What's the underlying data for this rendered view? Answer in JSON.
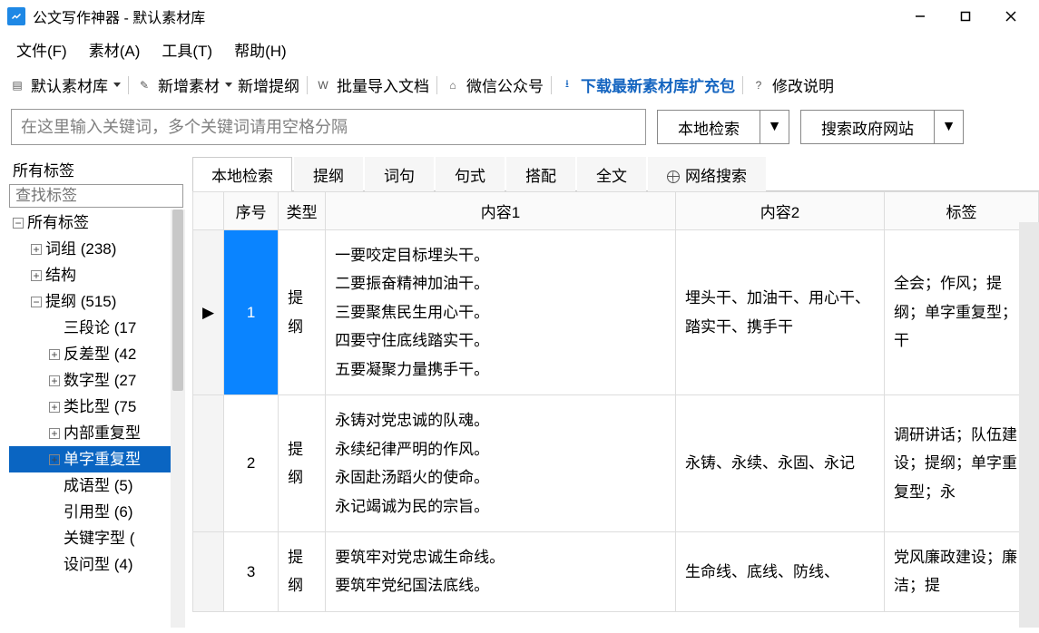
{
  "app": {
    "title": "公文写作神器 - 默认素材库"
  },
  "menu": {
    "file": "文件(F)",
    "material": "素材(A)",
    "tool": "工具(T)",
    "help": "帮助(H)"
  },
  "toolbar": {
    "default_lib": "默认素材库",
    "add_material": "新增素材",
    "add_outline": "新增提纲",
    "batch_import": "批量导入文档",
    "wechat": "微信公众号",
    "download_pack": "下载最新素材库扩充包",
    "changelog": "修改说明"
  },
  "search": {
    "placeholder": "在这里输入关键词，多个关键词请用空格分隔",
    "local_label": "本地检索",
    "gov_label": "搜索政府网站"
  },
  "sidebar": {
    "all_tags_title": "所有标签",
    "tag_search_placeholder": "查找标签",
    "tree": {
      "root": "所有标签",
      "ci": "词组 (238)",
      "struct": "结构",
      "tigang": "提纲 (515)",
      "sanduan": "三段论 (17",
      "fancha": "反差型 (42",
      "shuzi": "数字型 (27",
      "leibi": "类比型 (75",
      "neibu": "内部重复型",
      "danzi": "单字重复型",
      "chengyu": "成语型 (5)",
      "yinyong": "引用型 (6)",
      "guanjian": "关键字型 (",
      "shewen": "设问型 (4)"
    }
  },
  "tabs": {
    "t0": "本地检索",
    "t1": "提纲",
    "t2": "词句",
    "t3": "句式",
    "t4": "搭配",
    "t5": "全文",
    "t6": "网络搜索"
  },
  "table": {
    "headers": {
      "marker": "",
      "seq": "序号",
      "type": "类型",
      "c1": "内容1",
      "c2": "内容2",
      "tag": "标签"
    },
    "rows": [
      {
        "marker": "▶",
        "seq": "1",
        "type": "提纲",
        "c1": "一要咬定目标埋头干。\n二要振奋精神加油干。\n三要聚焦民生用心干。\n四要守住底线踏实干。\n五要凝聚力量携手干。",
        "c2": "埋头干、加油干、用心干、踏实干、携手干",
        "tag": "全会；作风；提纲；单字重复型；干"
      },
      {
        "marker": "",
        "seq": "2",
        "type": "提纲",
        "c1": "永铸对党忠诚的队魂。\n永续纪律严明的作风。\n永固赴汤蹈火的使命。\n永记竭诚为民的宗旨。",
        "c2": "永铸、永续、永固、永记",
        "tag": "调研讲话；队伍建设；提纲；单字重复型；永"
      },
      {
        "marker": "",
        "seq": "3",
        "type": "提纲",
        "c1": "要筑牢对党忠诚生命线。\n要筑牢党纪国法底线。",
        "c2": "生命线、底线、防线、",
        "tag": "党风廉政建设；廉洁；提"
      }
    ]
  }
}
